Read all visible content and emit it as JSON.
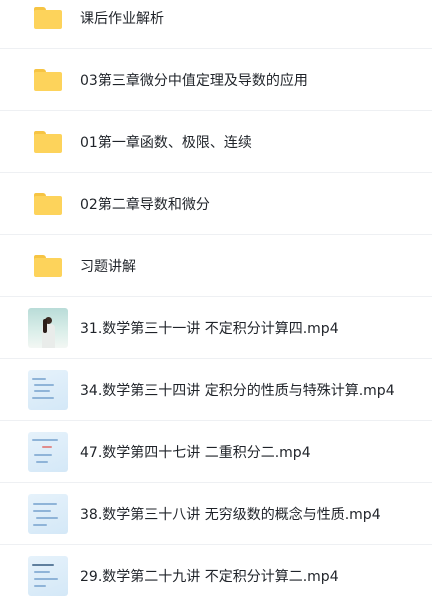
{
  "items": [
    {
      "type": "folder",
      "name": "课后作业解析",
      "icon": "folder-icon"
    },
    {
      "type": "folder",
      "name": "03第三章微分中值定理及导数的应用",
      "icon": "folder-icon"
    },
    {
      "type": "folder",
      "name": "01第一章函数、极限、连续",
      "icon": "folder-icon"
    },
    {
      "type": "folder",
      "name": "02第二章导数和微分",
      "icon": "folder-icon"
    },
    {
      "type": "folder",
      "name": "习题讲解",
      "icon": "folder-icon"
    },
    {
      "type": "video",
      "name": "31.数学第三十一讲 不定积分计算四.mp4",
      "icon": "video-thumbnail"
    },
    {
      "type": "video",
      "name": "34.数学第三十四讲 定积分的性质与特殊计算.mp4",
      "icon": "video-thumbnail"
    },
    {
      "type": "video",
      "name": "47.数学第四十七讲 二重积分二.mp4",
      "icon": "video-thumbnail"
    },
    {
      "type": "video",
      "name": "38.数学第三十八讲 无穷级数的概念与性质.mp4",
      "icon": "video-thumbnail"
    },
    {
      "type": "video",
      "name": "29.数学第二十九讲 不定积分计算二.mp4",
      "icon": "video-thumbnail"
    }
  ],
  "colors": {
    "folder": "#fdd35b",
    "folder_tab": "#f6c443",
    "text": "#1f2329",
    "divider": "#eef0f3"
  }
}
